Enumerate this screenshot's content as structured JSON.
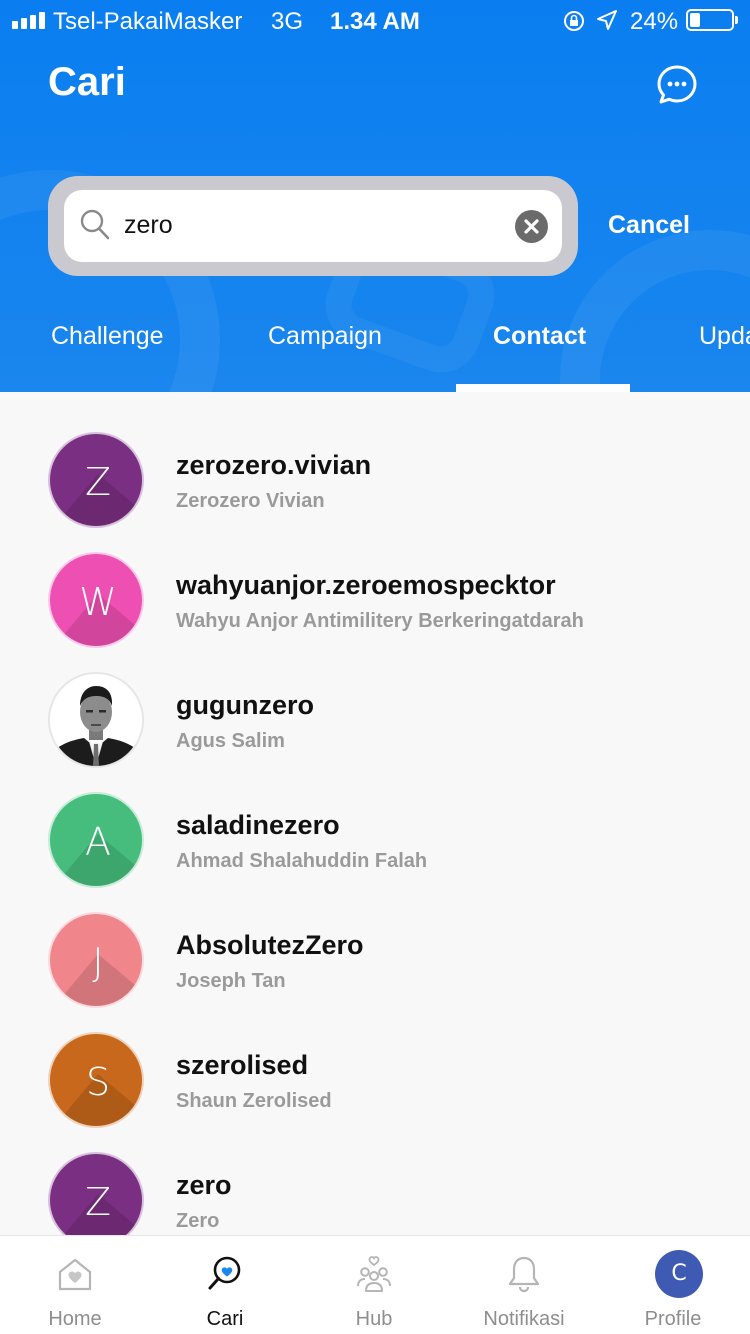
{
  "status_bar": {
    "carrier": "Tsel-PakaiMasker",
    "network": "3G",
    "time": "1.34 AM",
    "battery": "24%",
    "battery_level": 0.24
  },
  "header": {
    "title": "Cari",
    "chat_icon": "chat-bubble-icon"
  },
  "search": {
    "value": "zero",
    "placeholder": "",
    "cancel_label": "Cancel"
  },
  "tabs": [
    {
      "label": "Challenge",
      "active": false
    },
    {
      "label": "Campaign",
      "active": false
    },
    {
      "label": "Contact",
      "active": true
    },
    {
      "label": "Upda",
      "active": false
    }
  ],
  "contacts": [
    {
      "initial": "Z",
      "username": "zerozero.vivian",
      "name": "Zerozero Vivian",
      "color": "#7b2f82"
    },
    {
      "initial": "W",
      "username": "wahyuanjor.zeroemospecktor",
      "name": "Wahyu Anjor Antimilitery Berkeringatdarah",
      "color": "#ee4fb2"
    },
    {
      "initial": "",
      "username": "gugunzero",
      "name": "Agus Salim",
      "color": "#ffffff",
      "photo": true
    },
    {
      "initial": "A",
      "username": "saladinezero",
      "name": "Ahmad Shalahuddin Falah",
      "color": "#46bd7c"
    },
    {
      "initial": "J",
      "username": "AbsolutezZero",
      "name": "Joseph Tan",
      "color": "#f0868b"
    },
    {
      "initial": "S",
      "username": "szerolised",
      "name": "Shaun Zerolised",
      "color": "#c8681c"
    },
    {
      "initial": "Z",
      "username": "zero",
      "name": "Zero",
      "color": "#7b2f82"
    }
  ],
  "bottom_nav": [
    {
      "label": "Home",
      "icon": "home-icon",
      "active": false
    },
    {
      "label": "Cari",
      "icon": "search-heart-icon",
      "active": true
    },
    {
      "label": "Hub",
      "icon": "community-icon",
      "active": false
    },
    {
      "label": "Notifikasi",
      "icon": "bell-icon",
      "active": false
    },
    {
      "label": "Profile",
      "icon": "profile-avatar",
      "active": false,
      "avatar_initial": "C"
    }
  ],
  "colors": {
    "header_blue": "#0a7ef0",
    "profile_avatar": "#3f5ab3"
  }
}
